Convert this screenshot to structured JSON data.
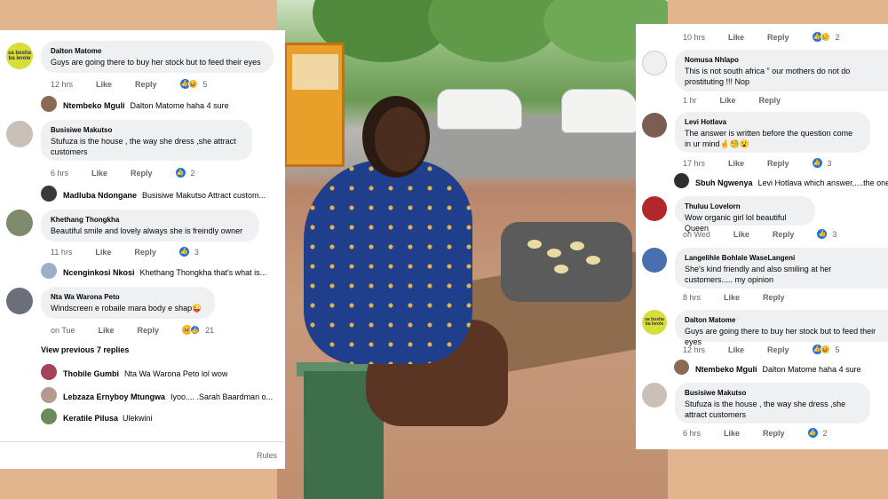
{
  "common": {
    "like": "Like",
    "reply": "Reply"
  },
  "left": {
    "c1": {
      "name": "Dalton Matome",
      "text": "Guys are going there to buy her stock but to feed their eyes",
      "time": "12 hrs",
      "count": "5",
      "avatar_text": "sa bosha ba lerole"
    },
    "r1": {
      "name": "Ntembeko Mguli",
      "text": "Dalton Matome haha 4 sure"
    },
    "c2": {
      "name": "Busisiwe Makutso",
      "text": "Stufuza is the house , the way  she dress ,she attract customers",
      "time": "6 hrs",
      "count": "2"
    },
    "r2": {
      "name": "Madluba Ndongane",
      "text": "Busisiwe Makutso Attract custom..."
    },
    "c3": {
      "name": "Khethang Thongkha",
      "text": "Beautiful smile and lovely always she is freindly owner",
      "time": "11 hrs",
      "count": "3"
    },
    "r3": {
      "name": "Ncenginkosi Nkosi",
      "text": "Khethang Thongkha  that's what is..."
    },
    "c4": {
      "name": "Nta Wa Warona Peto",
      "text": "Windscreen e robaile mara body e shap😜",
      "time": "on Tue",
      "count": "21"
    },
    "view_previous": "View previous 7 replies",
    "r4": {
      "name": "Thobile Gumbi",
      "text": "Nta Wa Warona Peto lol wow"
    },
    "r5": {
      "name": "Lebzaza Ernyboy Mtungwa",
      "text": "Iyoo.... .Sarah Baardman o..."
    },
    "r6": {
      "name": "Keratile Pilusa",
      "text": "Ulekwini"
    },
    "rules": "Rules"
  },
  "right": {
    "top_meta": {
      "time": "10 hrs",
      "count": "2"
    },
    "c1": {
      "name": "Nomusa Nhlapo",
      "text": "This is not south africa \" our mothers do not do prostituting !!! Nop",
      "time": "1 hr"
    },
    "c2": {
      "name": "Levi Hotlava",
      "text": "The answer is written before the question come in ur mind🤞🧐😮",
      "time": "17 hrs",
      "count": "3"
    },
    "r1": {
      "name": "Sbuh Ngwenya",
      "text": "Levi Hotlava which answer,....the one t..."
    },
    "c3": {
      "name": "Thuluu Lovelorn",
      "text": "Wow organic girl lol beautiful Queen",
      "time": "on Wed",
      "count": "3"
    },
    "c4": {
      "name": "Langelihle Bohlale WaseLangeni",
      "text": "She's kind friendly and also smiling at her customers..... my opinion",
      "time": "8 hrs"
    },
    "c5": {
      "name": "Dalton Matome",
      "text": "Guys are going there to buy her stock but to feed their eyes",
      "time": "12 hrs",
      "count": "5",
      "avatar_text": "sa bosha ba lerole"
    },
    "r2": {
      "name": "Ntembeko Mguli",
      "text": "Dalton Matome haha 4 sure"
    },
    "c6": {
      "name": "Busisiwe Makutso",
      "text": "Stufuza is the house , the way  she dress ,she attract customers",
      "time": "6 hrs",
      "count": "2"
    }
  },
  "colors": {
    "like_blue": "#1b74e4",
    "bubble_gray": "#eef0f2",
    "meta_gray": "#65676b",
    "backdrop": "#e3b58f"
  }
}
